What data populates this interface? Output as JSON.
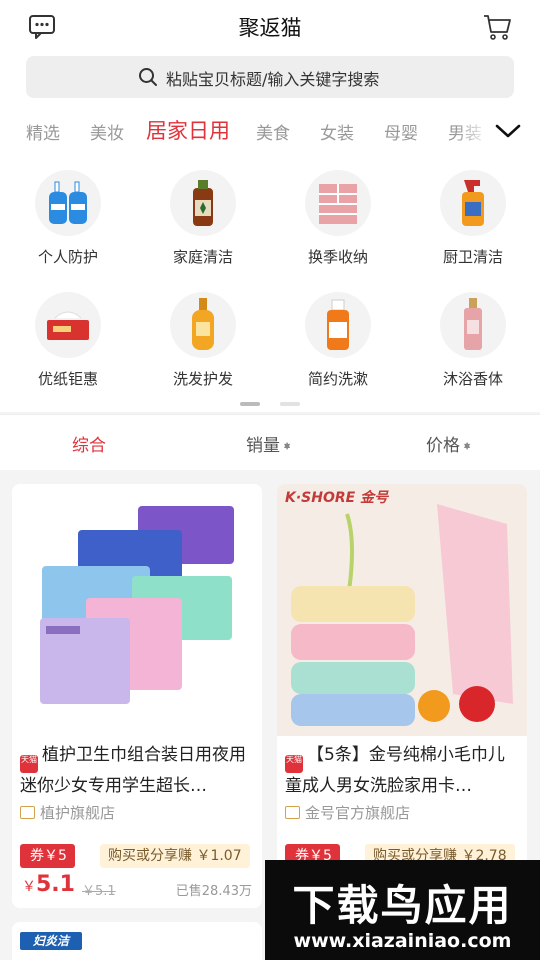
{
  "header": {
    "title": "聚返猫"
  },
  "search": {
    "placeholder": "粘贴宝贝标题/输入关键字搜索"
  },
  "tabs": [
    "精选",
    "美妆",
    "居家日用",
    "美食",
    "女装",
    "母婴",
    "男装"
  ],
  "active_tab": "居家日用",
  "categories": [
    {
      "label": "个人防护",
      "icon": "hand-wash-bottles-icon"
    },
    {
      "label": "家庭清洁",
      "icon": "disinfectant-bottle-icon"
    },
    {
      "label": "换季收纳",
      "icon": "storage-drawers-icon"
    },
    {
      "label": "厨卫清洁",
      "icon": "spray-cleaner-icon"
    },
    {
      "label": "优纸钜惠",
      "icon": "tissue-box-icon"
    },
    {
      "label": "洗发护发",
      "icon": "shampoo-bottle-icon"
    },
    {
      "label": "简约洗漱",
      "icon": "mouthwash-bottle-icon"
    },
    {
      "label": "沐浴香体",
      "icon": "body-mist-bottle-icon"
    }
  ],
  "sort": {
    "comprehensive": "综合",
    "sales": "销量",
    "price": "价格"
  },
  "products": [
    {
      "badge": "天猫",
      "name": "植护卫生巾组合装日用夜用迷你少女专用学生超长…",
      "shop": "植护旗舰店",
      "coupon": "券￥5",
      "share": "购买或分享赚 ￥1.07",
      "price_symbol": "￥",
      "price": "5.1",
      "original_price": "￥5.1",
      "sold": "已售28.43万"
    },
    {
      "badge": "天猫",
      "name": "【5条】金号纯棉小毛巾儿童成人男女洗脸家用卡…",
      "shop": "金号官方旗舰店",
      "coupon": "券￥5",
      "share": "购买或分享赚 ￥2.78",
      "brand_logo": "K·SHORE 金号"
    }
  ],
  "next_product": {
    "brand_logo": "妇炎洁"
  },
  "watermark": {
    "text": "下载鸟应用",
    "url": "www.xiazainiao.com"
  },
  "colors": {
    "accent": "#e0323a",
    "coupon_bg": "#fff2d9",
    "watermark_green": "#8ed41f"
  }
}
